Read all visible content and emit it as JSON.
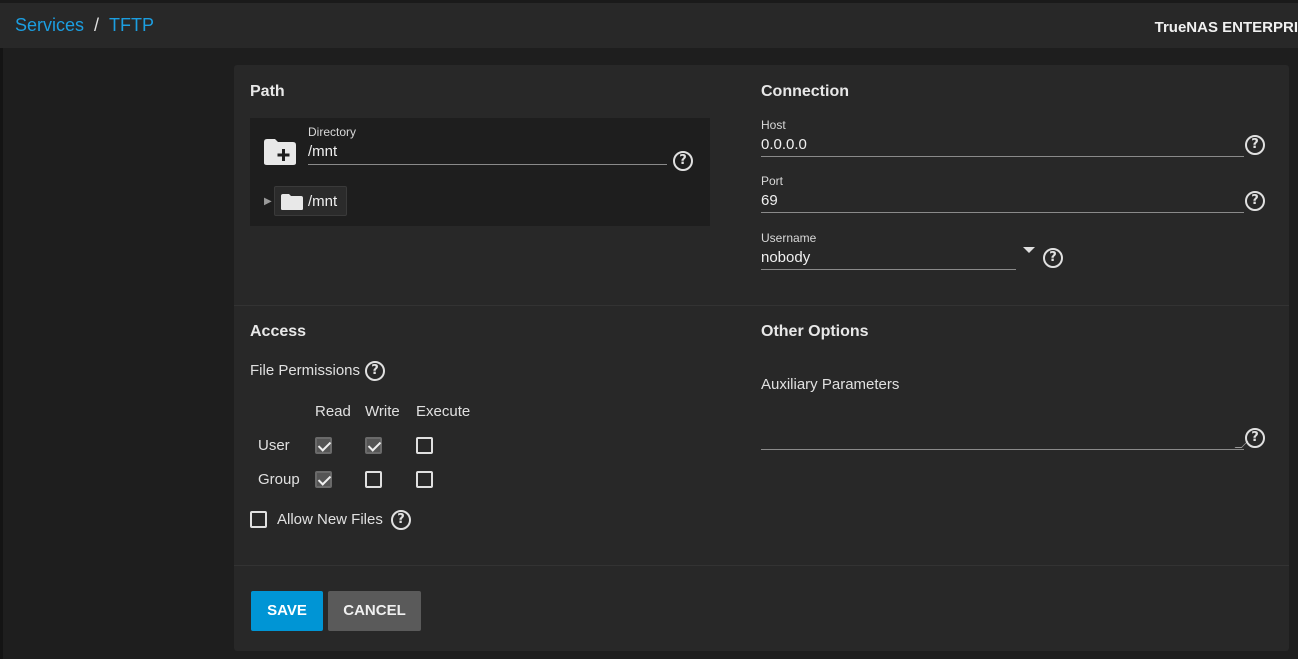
{
  "breadcrumb": {
    "parent": "Services",
    "separator": "/",
    "current": "TFTP"
  },
  "brand": "TrueNAS ENTERPRISE",
  "path": {
    "title": "Path",
    "directory_label": "Directory",
    "directory_value": "/mnt",
    "tree_node": "/mnt"
  },
  "connection": {
    "title": "Connection",
    "host_label": "Host",
    "host_value": "0.0.0.0",
    "port_label": "Port",
    "port_value": "69",
    "username_label": "Username",
    "username_value": "nobody"
  },
  "access": {
    "title": "Access",
    "file_permissions_label": "File Permissions",
    "columns": [
      "Read",
      "Write",
      "Execute"
    ],
    "rows": [
      {
        "label": "User",
        "checked": [
          true,
          true,
          false
        ]
      },
      {
        "label": "Group",
        "checked": [
          true,
          false,
          false
        ]
      }
    ],
    "allow_new_files_label": "Allow New Files",
    "allow_new_files": false
  },
  "other": {
    "title": "Other Options",
    "aux_label": "Auxiliary Parameters",
    "aux_value": ""
  },
  "actions": {
    "save": "SAVE",
    "cancel": "CANCEL"
  },
  "help_glyph": "?",
  "colors": {
    "accent": "#0095d5",
    "link": "#1c9ee0",
    "card": "#282828",
    "background": "#1e1e1e"
  }
}
